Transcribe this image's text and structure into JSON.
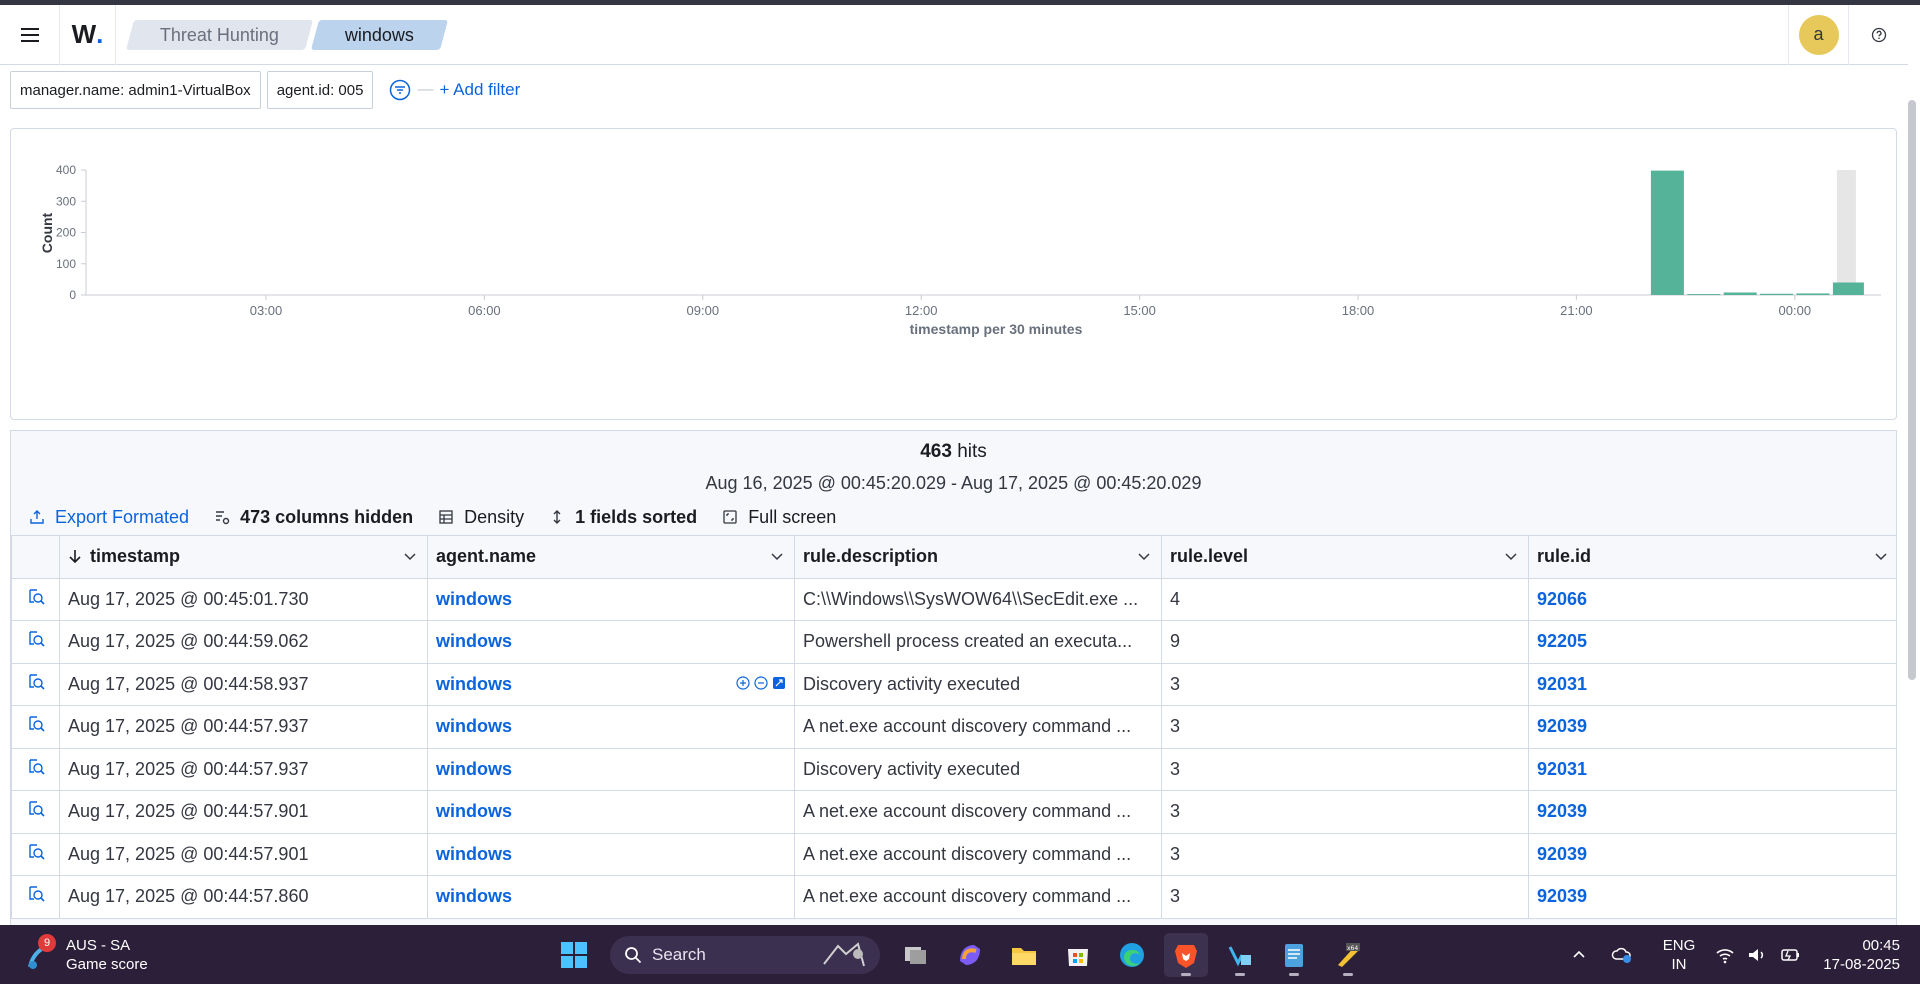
{
  "header": {
    "logo": "W.",
    "breadcrumbs": [
      "Threat Hunting",
      "windows"
    ],
    "avatar_initial": "a"
  },
  "filters": {
    "pills": [
      "manager.name: admin1-VirtualBox",
      "agent.id: 005"
    ],
    "add_filter_label": "+ Add filter"
  },
  "chart_data": {
    "type": "bar",
    "ylabel": "Count",
    "xlabel": "timestamp per 30 minutes",
    "x_tick_labels": [
      "03:00",
      "06:00",
      "09:00",
      "12:00",
      "15:00",
      "18:00",
      "21:00",
      "00:00"
    ],
    "y_ticks": [
      0,
      100,
      200,
      300,
      400
    ],
    "ylim": [
      0,
      400
    ],
    "bar_color": "#54b399",
    "partial_bucket_color": "#e6e6e6",
    "bars": [
      {
        "time": "22:00",
        "value": 398
      },
      {
        "time": "22:30",
        "value": 3
      },
      {
        "time": "23:00",
        "value": 8
      },
      {
        "time": "23:30",
        "value": 4
      },
      {
        "time": "00:00",
        "value": 5
      },
      {
        "time": "00:30",
        "value": 40
      }
    ],
    "partial_bucket": {
      "time": "00:30",
      "value": 400
    }
  },
  "results": {
    "hits_count": "463",
    "hits_label": "hits",
    "time_range": "Aug 16, 2025 @ 00:45:20.029 - Aug 17, 2025 @ 00:45:20.029",
    "toolbar": {
      "export": "Export Formated",
      "columns_hidden": "473 columns hidden",
      "density": "Density",
      "sorted": "1 fields sorted",
      "fullscreen": "Full screen"
    },
    "columns": [
      "timestamp",
      "agent.name",
      "rule.description",
      "rule.level",
      "rule.id"
    ],
    "rows": [
      [
        "Aug 17, 2025 @ 00:45:01.730",
        "windows",
        "C:\\\\Windows\\\\SysWOW64\\\\SecEdit.exe ...",
        "4",
        "92066"
      ],
      [
        "Aug 17, 2025 @ 00:44:59.062",
        "windows",
        "Powershell process created an executa...",
        "9",
        "92205"
      ],
      [
        "Aug 17, 2025 @ 00:44:58.937",
        "windows",
        "Discovery activity executed",
        "3",
        "92031"
      ],
      [
        "Aug 17, 2025 @ 00:44:57.937",
        "windows",
        "A net.exe account discovery command ...",
        "3",
        "92039"
      ],
      [
        "Aug 17, 2025 @ 00:44:57.937",
        "windows",
        "Discovery activity executed",
        "3",
        "92031"
      ],
      [
        "Aug 17, 2025 @ 00:44:57.901",
        "windows",
        "A net.exe account discovery command ...",
        "3",
        "92039"
      ],
      [
        "Aug 17, 2025 @ 00:44:57.901",
        "windows",
        "A net.exe account discovery command ...",
        "3",
        "92039"
      ],
      [
        "Aug 17, 2025 @ 00:44:57.860",
        "windows",
        "A net.exe account discovery command ...",
        "3",
        "92039"
      ]
    ]
  },
  "taskbar": {
    "weather_badge": "9",
    "weather_title": "AUS - SA",
    "weather_sub": "Game score",
    "search_placeholder": "Search",
    "lang_top": "ENG",
    "lang_bottom": "IN",
    "time": "00:45",
    "date": "17-08-2025"
  }
}
